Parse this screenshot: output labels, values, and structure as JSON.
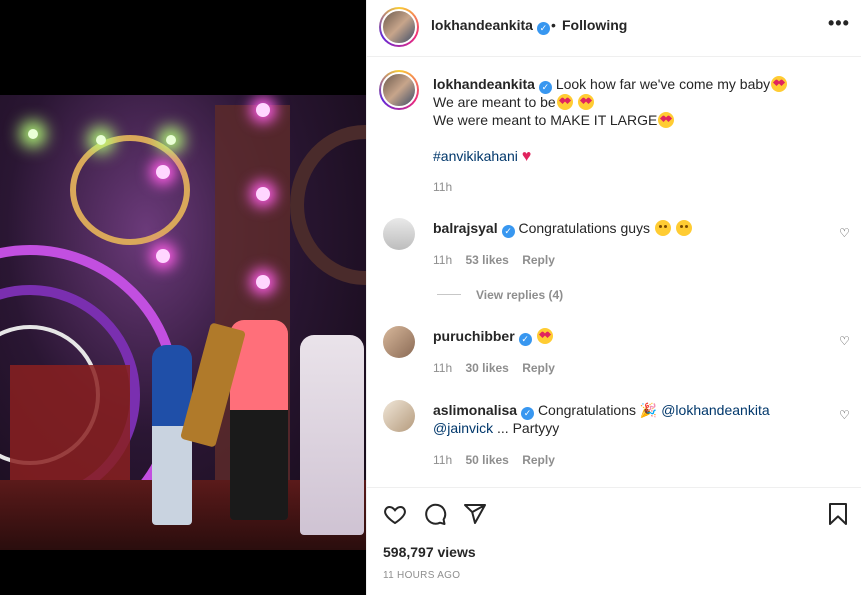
{
  "post": {
    "author": "lokhandeankita",
    "follow_status": "Following",
    "separator": "•",
    "more_label": "•••",
    "caption_lines": [
      "Look how far we've come my baby",
      "We are meant to be",
      "We were meant to MAKE IT LARGE"
    ],
    "hashtag": "#anvikikahani",
    "caption_time": "11h",
    "views": "598,797 views",
    "posted_ago": "11 HOURS AGO"
  },
  "comments": [
    {
      "username": "balrajsyal",
      "text": "Congratulations guys",
      "time": "11h",
      "likes": "53 likes",
      "reply": "Reply",
      "view_replies": "View replies (4)"
    },
    {
      "username": "puruchibber",
      "text": "",
      "time": "11h",
      "likes": "30 likes",
      "reply": "Reply"
    },
    {
      "username": "aslimonalisa",
      "text": "Congratulations",
      "mention1": "@lokhandeankita",
      "mention2": "@jainvick",
      "text2": "... Partyyy",
      "time": "11h",
      "likes": "50 likes",
      "reply": "Reply"
    }
  ],
  "icons": {
    "like": "heart-icon",
    "comment": "comment-icon",
    "share": "share-icon",
    "save": "bookmark-icon",
    "verified": "verified-badge-icon"
  },
  "colors": {
    "verified": "#3897f0",
    "link": "#00376b",
    "muted": "#8e8e8e"
  }
}
